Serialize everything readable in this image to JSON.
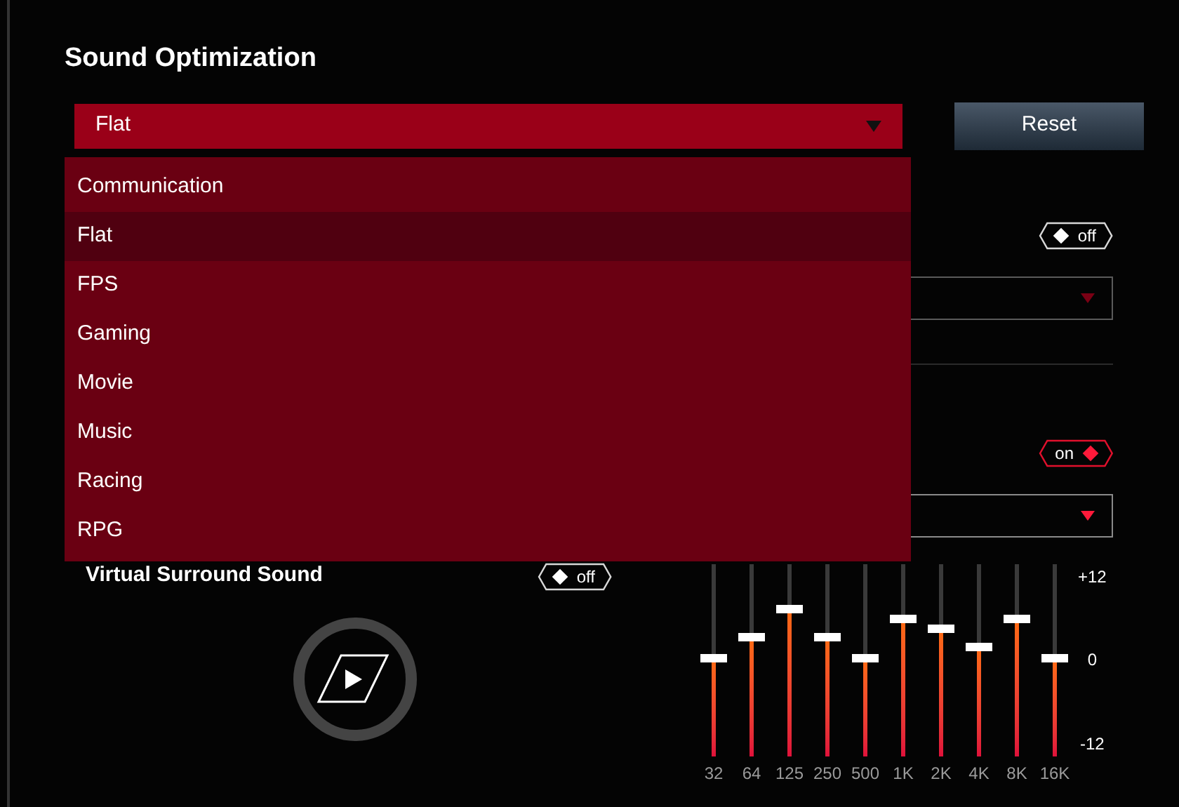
{
  "title": "Sound Optimization",
  "preset": {
    "value": "Flat",
    "expanded": true,
    "options": [
      {
        "label": "Communication",
        "selected": false
      },
      {
        "label": "Flat",
        "selected": true
      },
      {
        "label": "FPS",
        "selected": false
      },
      {
        "label": "Gaming",
        "selected": false
      },
      {
        "label": "Movie",
        "selected": false
      },
      {
        "label": "Music",
        "selected": false
      },
      {
        "label": "Racing",
        "selected": false
      },
      {
        "label": "RPG",
        "selected": false
      }
    ]
  },
  "reset_button": "Reset",
  "right_settings": [
    {
      "toggle": {
        "label": "off",
        "on": false
      },
      "select": {
        "disabled": true
      }
    },
    {
      "toggle": {
        "label": "on",
        "on": true
      },
      "select": {
        "disabled": false
      }
    }
  ],
  "virtual_surround": {
    "label": "Virtual Surround Sound",
    "toggle": {
      "label": "off",
      "on": false
    }
  },
  "equalizer": {
    "scale": [
      "+12",
      "0",
      "-12"
    ],
    "bands": [
      {
        "label": "32",
        "level": 0.5
      },
      {
        "label": "64",
        "level": 0.62
      },
      {
        "label": "125",
        "level": 0.79
      },
      {
        "label": "250",
        "level": 0.62
      },
      {
        "label": "500",
        "level": 0.5
      },
      {
        "label": "1K",
        "level": 0.73
      },
      {
        "label": "2K",
        "level": 0.67
      },
      {
        "label": "4K",
        "level": 0.56
      },
      {
        "label": "8K",
        "level": 0.73
      },
      {
        "label": "16K",
        "level": 0.5
      }
    ]
  }
}
